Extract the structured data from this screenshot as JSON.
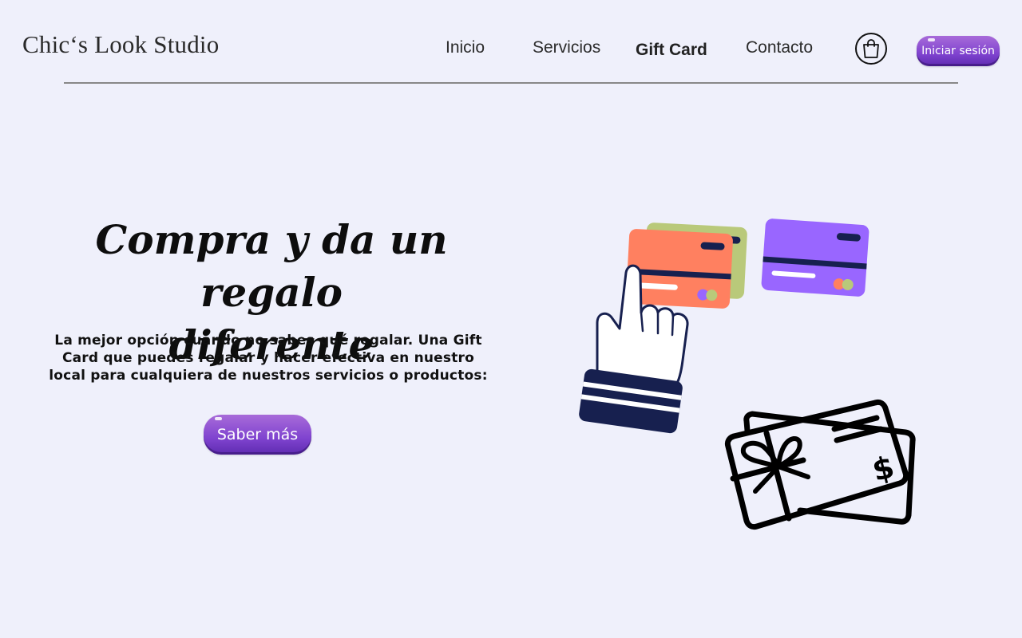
{
  "header": {
    "brand": "Chic‘s Look Studio",
    "nav": [
      "Inicio",
      "Servicios",
      "Gift Card",
      "Contacto"
    ],
    "active_nav": "Gift Card",
    "login_label": "Iniciar sesión",
    "cart_icon": "shopping-bag-icon"
  },
  "hero": {
    "title_line1": "Compra y da un regalo",
    "title_line2": "diferente",
    "description": "La mejor opción cuando no sabes qué regalar. Una Gift Card que puedes regalar y hacer efectiva en nuestro local para cualquiera de nuestros servicios o productos:",
    "cta_label": "Saber más"
  },
  "colors": {
    "background": "#eff0fb",
    "button_accent": "#7f43cf",
    "card_orange": "#ff8060",
    "card_green": "#b9c97a",
    "card_purple": "#9966ff",
    "navy": "#17204f"
  }
}
